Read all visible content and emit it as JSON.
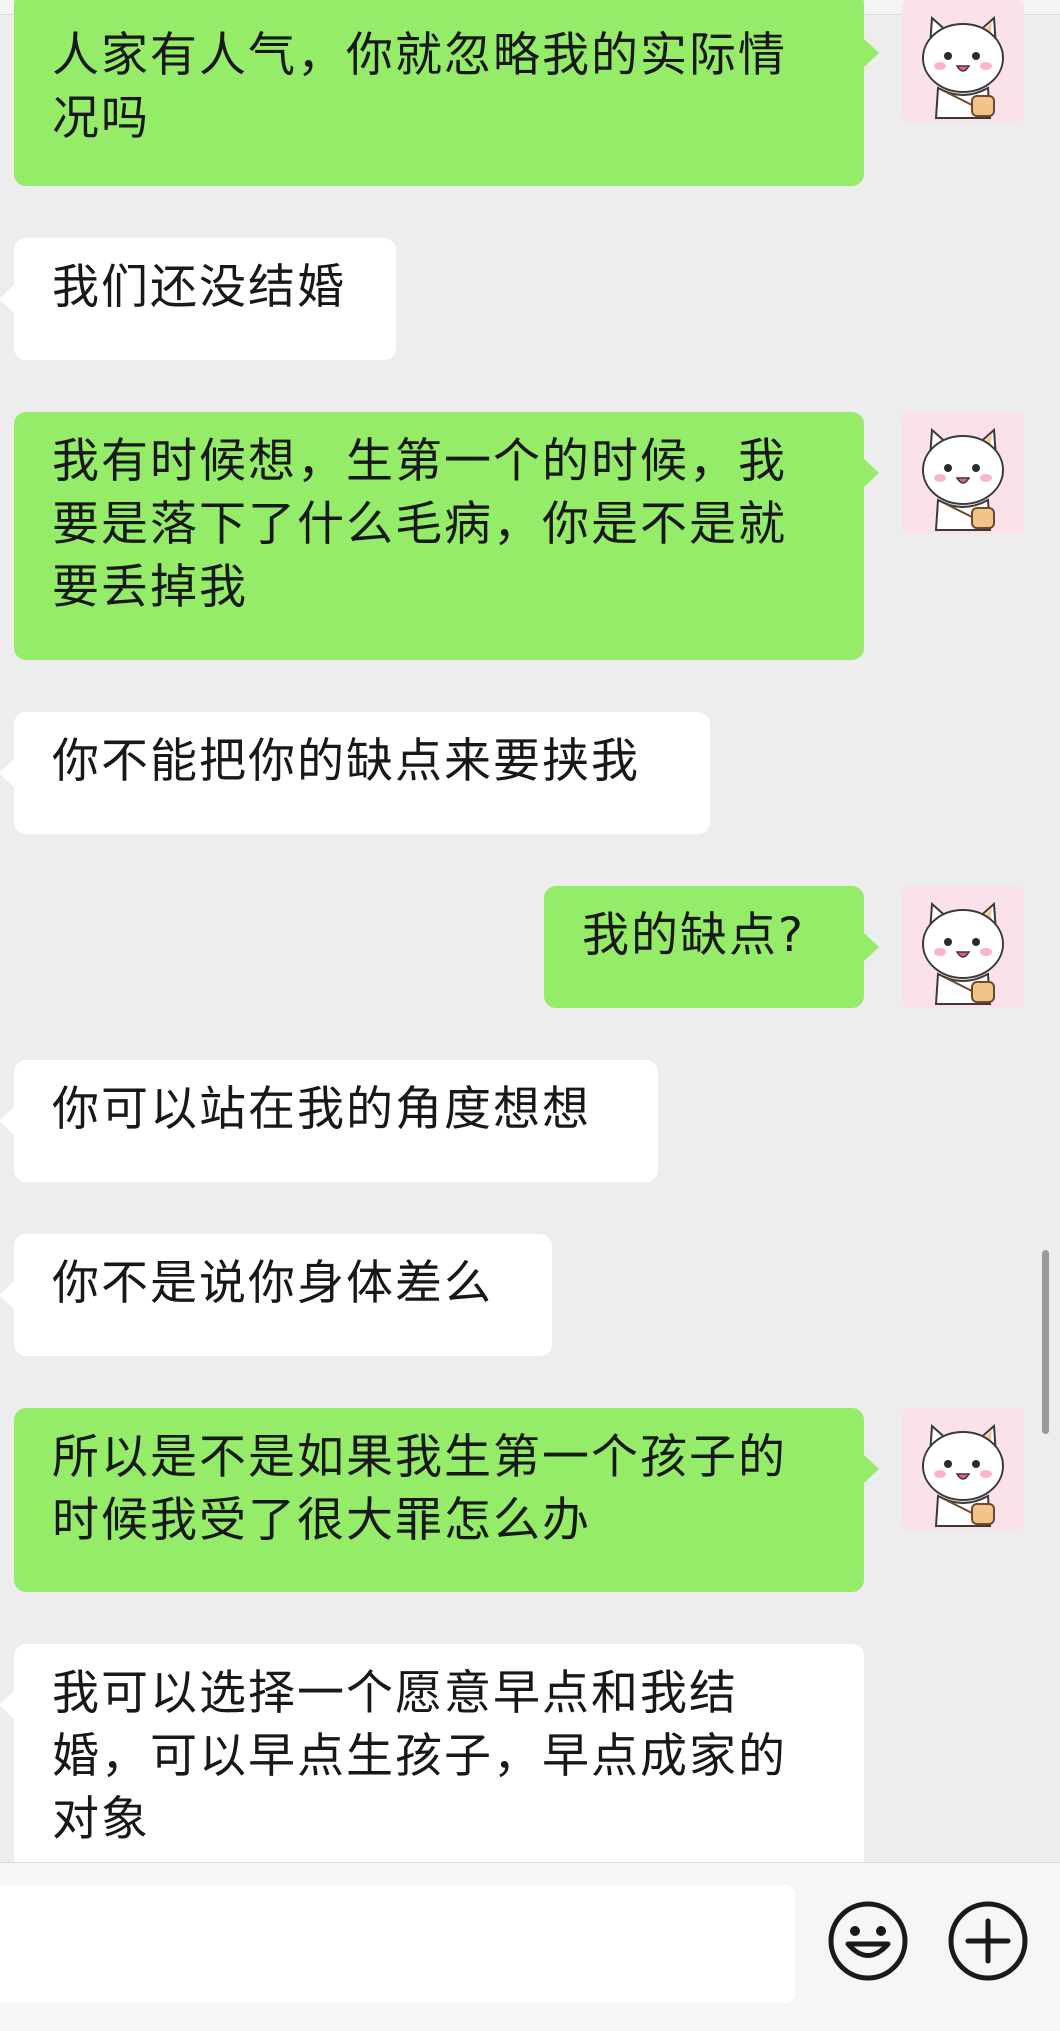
{
  "messages": [
    {
      "sender": "me",
      "text": "人家有人气，你就忽略我的实际情况吗"
    },
    {
      "sender": "them",
      "text": "我们还没结婚"
    },
    {
      "sender": "me",
      "text": "我有时候想，生第一个的时候，我要是落下了什么毛病，你是不是就要丢掉我"
    },
    {
      "sender": "them",
      "text": "你不能把你的缺点来要挟我"
    },
    {
      "sender": "me",
      "text": "我的缺点?"
    },
    {
      "sender": "them",
      "text": "你可以站在我的角度想想"
    },
    {
      "sender": "them",
      "text": "你不是说你身体差么"
    },
    {
      "sender": "me",
      "text": "所以是不是如果我生第一个孩子的时候我受了很大罪怎么办"
    },
    {
      "sender": "them",
      "text": "我可以选择一个愿意早点和我结婚，可以早点生孩子，早点成家的对象"
    }
  ],
  "avatar": {
    "icon": "kitten-avatar-icon",
    "background": "#fbe2ea"
  },
  "input_bar": {
    "input_value": "",
    "emoji_icon": "smiley-icon",
    "plus_icon": "plus-circle-icon"
  },
  "colors": {
    "background": "#ededed",
    "my_bubble": "#95ec69",
    "their_bubble": "#ffffff",
    "text": "#181818"
  }
}
